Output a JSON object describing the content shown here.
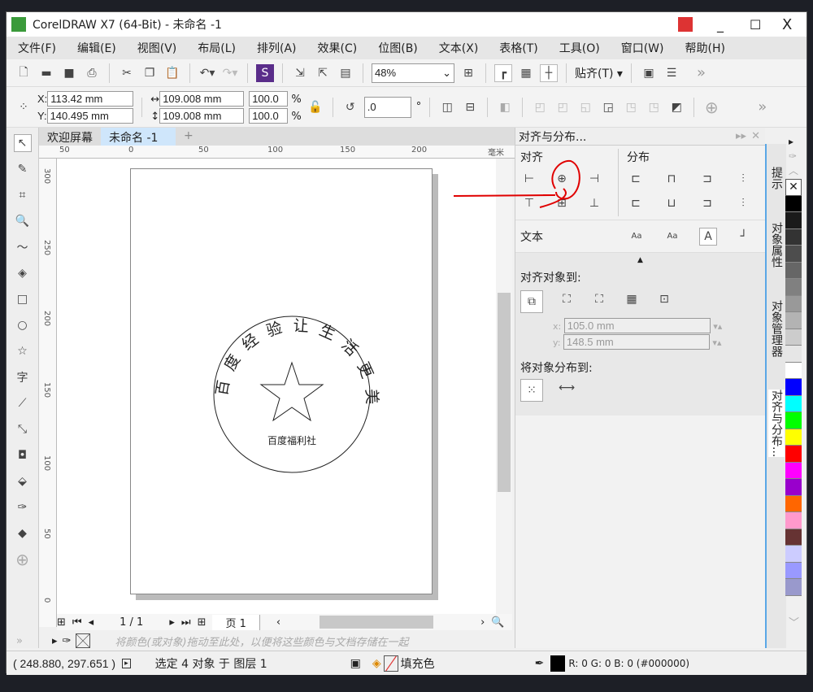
{
  "window": {
    "title": "CorelDRAW X7 (64-Bit) - 未命名 -1",
    "minimize": "_",
    "maximize": "☐",
    "close": "X"
  },
  "menu": [
    "文件(F)",
    "编辑(E)",
    "视图(V)",
    "布局(L)",
    "排列(A)",
    "效果(C)",
    "位图(B)",
    "文本(X)",
    "表格(T)",
    "工具(O)",
    "窗口(W)",
    "帮助(H)"
  ],
  "toolbar": {
    "zoom": "48%",
    "snap": "贴齐(T)",
    "more": "»"
  },
  "property_bar": {
    "x_label": "X:",
    "x": "113.42 mm",
    "y_label": "Y:",
    "y": "140.495 mm",
    "width": "109.008 mm",
    "height": "109.008 mm",
    "scale_x": "100.0",
    "scale_y": "100.0",
    "pct": "%",
    "rotation": ".0",
    "deg": "°"
  },
  "doc_tabs": [
    "欢迎屏幕",
    "未命名 -1"
  ],
  "ruler": {
    "h_ticks": [
      "50",
      "0",
      "50",
      "100",
      "150",
      "200"
    ],
    "unit": "毫米",
    "v_ticks": [
      "300",
      "250",
      "200",
      "150",
      "100",
      "50",
      "0"
    ]
  },
  "stamp": {
    "arc_text": "百度经验让生活更美好",
    "bottom_text": "百度福利社"
  },
  "page_nav": {
    "count": "1 / 1",
    "page_tab": "页 1"
  },
  "palette_hint": "将颜色(或对象)拖动至此处，以便将这些颜色与文档存储在一起",
  "docker": {
    "title": "对齐与分布...",
    "align": "对齐",
    "distribute": "分布",
    "text": "文本",
    "align_to": "对齐对象到:",
    "x_label": "x:",
    "x_value": "105.0 mm",
    "y_label": "y:",
    "y_value": "148.5 mm",
    "distribute_to": "将对象分布到:"
  },
  "side_tabs": [
    "提示",
    "对象属性",
    "对象管理器",
    "对齐与分布..."
  ],
  "palette_colors": [
    "#000000",
    "#1a1a1a",
    "#333333",
    "#4d4d4d",
    "#666666",
    "#808080",
    "#999999",
    "#b3b3b3",
    "#cccccc",
    "#e6e6e6",
    "#ffffff",
    "#0000ff",
    "#00ffff",
    "#00ff00",
    "#ffff00",
    "#ff0000",
    "#ff00ff",
    "#9900cc",
    "#ff6600",
    "#ff99cc",
    "#663333",
    "#ccccff",
    "#9999ff",
    "#9999cc"
  ],
  "status": {
    "coords": "( 248.880, 297.651 )",
    "selection": "选定 4 对象 于 图层 1",
    "fill": "填充色",
    "outline": "R: 0 G: 0 B: 0 (#000000)"
  },
  "annotation_color": "#e00000"
}
